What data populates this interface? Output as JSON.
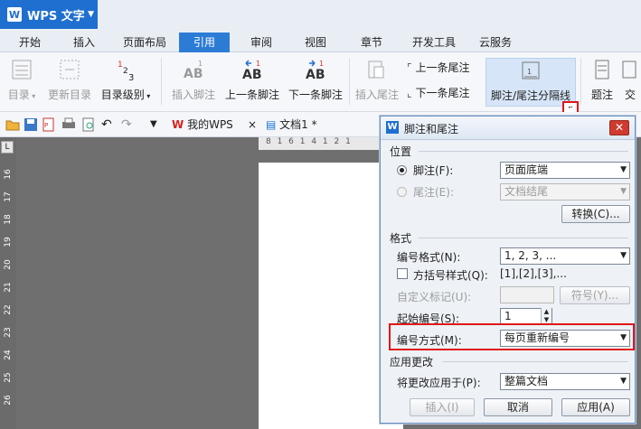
{
  "app": {
    "title": "WPS 文字"
  },
  "tabs": [
    "开始",
    "插入",
    "页面布局",
    "引用",
    "审阅",
    "视图",
    "章节",
    "开发工具",
    "云服务"
  ],
  "active_tab": "引用",
  "ribbon": {
    "toc": "目录",
    "update_toc": "更新目录",
    "toc_level": "目录级别",
    "insert_footnote": "插入脚注",
    "prev_footnote": "上一条脚注",
    "next_footnote": "下一条脚注",
    "insert_endnote": "插入尾注",
    "prev_endnote": "上一条尾注",
    "next_endnote": "下一条尾注",
    "separator": "脚注/尾注分隔线",
    "caption": "题注",
    "cross_ref": "交"
  },
  "qat": {
    "my_wps": "我的WPS",
    "doc_tab": "文档1 *"
  },
  "ruler": {
    "top": "8 1 6 1 4 1 2 1",
    "left": [
      "16",
      "17",
      "18",
      "19",
      "20",
      "21",
      "22",
      "23",
      "24",
      "25",
      "26"
    ]
  },
  "dialog": {
    "title": "脚注和尾注",
    "position_section": "位置",
    "footnote_label": "脚注(F):",
    "footnote_value": "页面底端",
    "endnote_label": "尾注(E):",
    "endnote_value": "文档结尾",
    "convert_button": "转换(C)...",
    "format_section": "格式",
    "number_format_label": "编号格式(N):",
    "number_format_value": "1, 2, 3, ...",
    "bracket_label": "方括号样式(Q):",
    "bracket_value": "[1],[2],[3],...",
    "custom_mark_label": "自定义标记(U):",
    "symbol_button": "符号(Y)...",
    "start_number_label": "起始编号(S):",
    "start_number_value": "1",
    "numbering_label": "编号方式(M):",
    "numbering_value": "每页重新编号",
    "apply_section": "应用更改",
    "apply_to_label": "将更改应用于(P):",
    "apply_to_value": "整篇文档",
    "insert_button": "插入(I)",
    "cancel_button": "取消",
    "apply_button": "应用(A)"
  }
}
